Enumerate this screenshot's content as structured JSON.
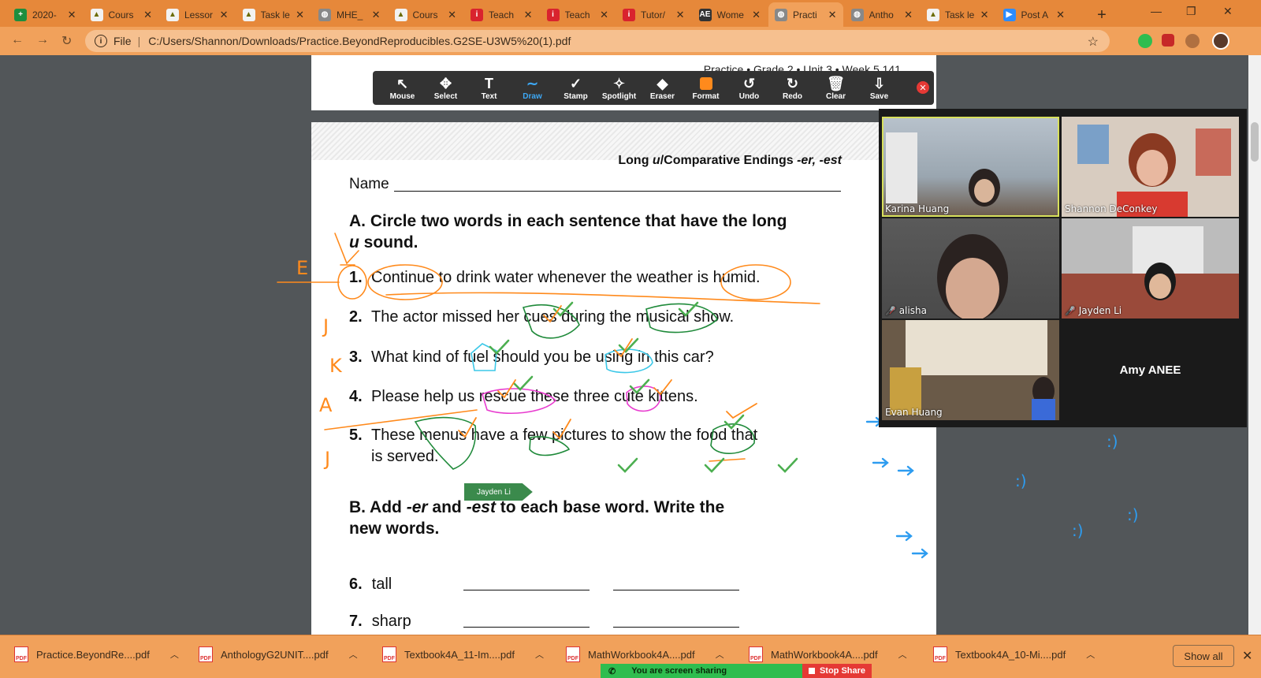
{
  "tabs": [
    {
      "title": "2020-",
      "color": "#1e8e3e",
      "glyph": "+"
    },
    {
      "title": "Cours",
      "color": "#f2f2f2",
      "glyph": "▲"
    },
    {
      "title": "Lessor",
      "color": "#f2f2f2",
      "glyph": "▲"
    },
    {
      "title": "Task le",
      "color": "#f2f2f2",
      "glyph": "▲"
    },
    {
      "title": "MHE_",
      "color": "#888888",
      "glyph": "◍"
    },
    {
      "title": "Cours",
      "color": "#f2f2f2",
      "glyph": "▲"
    },
    {
      "title": "Teach",
      "color": "#d9232e",
      "glyph": "i"
    },
    {
      "title": "Teach",
      "color": "#d9232e",
      "glyph": "i"
    },
    {
      "title": "Tutor/",
      "color": "#d9232e",
      "glyph": "i"
    },
    {
      "title": "Wome",
      "color": "#333333",
      "glyph": "AE"
    },
    {
      "title": "Practi",
      "color": "#888888",
      "glyph": "◍",
      "active": true
    },
    {
      "title": "Antho",
      "color": "#888888",
      "glyph": "◍"
    },
    {
      "title": "Task le",
      "color": "#f2f2f2",
      "glyph": "▲"
    },
    {
      "title": "Post A",
      "color": "#2d8cff",
      "glyph": "▶"
    }
  ],
  "omnibox": {
    "scheme": "File",
    "url": "C:/Users/Shannon/Downloads/Practice.BeyondReproducibles.G2SE-U3W5%20(1).pdf"
  },
  "pdf": {
    "page_header": "Practice • Grade 2 • Unit 3 • Week 5   141",
    "title_prefix": "Long ",
    "title_u": "u",
    "title_mid": "/Comparative Endings ",
    "title_end": "-er, -est",
    "name_label": "Name",
    "section_a_l1": "A. Circle two words in each sentence that have the long",
    "section_a_u": "u",
    "section_a_l2": " sound.",
    "items": [
      {
        "num": "1.",
        "text": "Continue to drink water whenever the weather is humid."
      },
      {
        "num": "2.",
        "text": "The actor missed her cues during the musical show."
      },
      {
        "num": "3.",
        "text": "What kind of fuel should you be using in this car?"
      },
      {
        "num": "4.",
        "text": "Please help us rescue these three cute kittens."
      },
      {
        "num": "5.",
        "text": "These menus have a few pictures to show the food that",
        "text2": "is served."
      }
    ],
    "section_b_p1": "B. Add ",
    "section_b_er": "-er",
    "section_b_p2": " and ",
    "section_b_est": "-est",
    "section_b_p3": " to each base word. Write the new words.",
    "fill": [
      {
        "num": "6.",
        "word": "tall"
      },
      {
        "num": "7.",
        "word": "sharp"
      }
    ]
  },
  "annotate": {
    "tools": [
      {
        "icon": "↖",
        "label": "Mouse",
        "name": "mouse-tool"
      },
      {
        "icon": "✥",
        "label": "Select",
        "name": "select-tool"
      },
      {
        "icon": "T",
        "label": "Text",
        "name": "text-tool"
      },
      {
        "icon": "∼",
        "label": "Draw",
        "name": "draw-tool",
        "active": true
      },
      {
        "icon": "✓",
        "label": "Stamp",
        "name": "stamp-tool"
      },
      {
        "icon": "✧",
        "label": "Spotlight",
        "name": "spotlight-tool"
      },
      {
        "icon": "◆",
        "label": "Eraser",
        "name": "eraser-tool"
      },
      {
        "icon": "",
        "label": "Format",
        "name": "format-tool",
        "swatch": "#ff8a1c"
      },
      {
        "icon": "↺",
        "label": "Undo",
        "name": "undo-tool"
      },
      {
        "icon": "↻",
        "label": "Redo",
        "name": "redo-tool"
      },
      {
        "icon": "🗑",
        "label": "Clear",
        "name": "clear-tool"
      },
      {
        "icon": "⇩",
        "label": "Save",
        "name": "save-tool"
      }
    ],
    "cursor_label": "Jayden Li",
    "teacher_letters": [
      "E",
      "J",
      "K",
      "A",
      "J"
    ],
    "smileys": [
      ":)",
      ":)",
      ":)",
      ":)"
    ]
  },
  "gallery": {
    "participants": [
      {
        "name": "Karina Huang",
        "muted": false,
        "speaking": true
      },
      {
        "name": "Shannon DeConkey",
        "muted": false
      },
      {
        "name": "alisha",
        "muted": true
      },
      {
        "name": "Jayden Li",
        "muted": true
      },
      {
        "name": "Evan Huang",
        "muted": false
      },
      {
        "name": "Amy ANEE",
        "muted": false,
        "video": false
      }
    ]
  },
  "downloads": [
    {
      "name": "Practice.BeyondRe....pdf"
    },
    {
      "name": "AnthologyG2UNIT....pdf"
    },
    {
      "name": "Textbook4A_11-Im....pdf"
    },
    {
      "name": "MathWorkbook4A....pdf"
    },
    {
      "name": "MathWorkbook4A....pdf"
    },
    {
      "name": "Textbook4A_10-Mi....pdf"
    }
  ],
  "show_all": "Show all",
  "share": {
    "status": "You are screen sharing",
    "stop": "Stop Share"
  },
  "colors": {
    "orange_ink": "#ff8a1c",
    "green_ink": "#1f8a3a",
    "check_green": "#4caf50",
    "cyan_ink": "#3cc8e8",
    "magenta_ink": "#e83ccf",
    "blue_ink": "#2d9cf0"
  }
}
